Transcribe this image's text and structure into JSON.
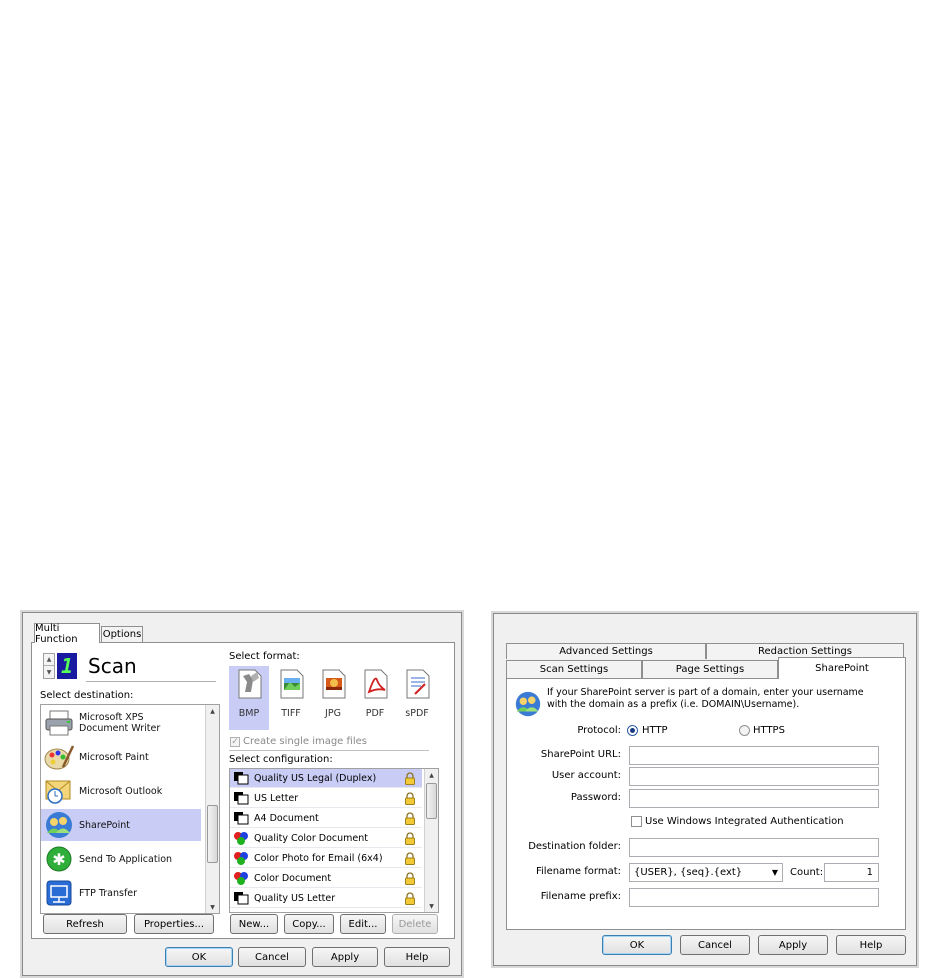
{
  "left_dialog": {
    "tabs": [
      "Multi Function",
      "Options"
    ],
    "function_title": "Scan",
    "function_number": "1",
    "select_destination_label": "Select destination:",
    "destinations": [
      {
        "label": "Microsoft XPS Document Writer",
        "icon": "printer-icon"
      },
      {
        "label": "Microsoft Paint",
        "icon": "paint-palette-icon"
      },
      {
        "label": "Microsoft Outlook",
        "icon": "outlook-icon"
      },
      {
        "label": "SharePoint",
        "icon": "sharepoint-icon",
        "selected": true
      },
      {
        "label": "Send To Application",
        "icon": "send-to-app-icon"
      },
      {
        "label": "FTP Transfer",
        "icon": "ftp-icon"
      }
    ],
    "select_format_label": "Select format:",
    "formats": [
      {
        "label": "BMP",
        "icon": "bmp-icon",
        "selected": true
      },
      {
        "label": "TIFF",
        "icon": "tiff-icon"
      },
      {
        "label": "JPG",
        "icon": "jpg-icon"
      },
      {
        "label": "PDF",
        "icon": "pdf-icon"
      },
      {
        "label": "sPDF",
        "icon": "spdf-icon"
      }
    ],
    "create_single_image_label": "Create single image files",
    "select_configuration_label": "Select configuration:",
    "configurations": [
      {
        "label": "Quality US Legal (Duplex)",
        "icon": "bw-doc-icon",
        "selected": true
      },
      {
        "label": "US Letter",
        "icon": "bw-doc-icon"
      },
      {
        "label": "A4 Document",
        "icon": "bw-doc-icon"
      },
      {
        "label": "Quality Color Document",
        "icon": "color-doc-icon"
      },
      {
        "label": "Color Photo for Email (6x4)",
        "icon": "color-doc-icon"
      },
      {
        "label": "Color Document",
        "icon": "color-doc-icon"
      },
      {
        "label": "Quality US Letter",
        "icon": "bw-doc-icon"
      }
    ],
    "buttons": {
      "refresh": "Refresh",
      "properties": "Properties...",
      "new": "New...",
      "copy": "Copy...",
      "edit": "Edit...",
      "delete": "Delete",
      "ok": "OK",
      "cancel": "Cancel",
      "apply": "Apply",
      "help": "Help"
    }
  },
  "right_dialog": {
    "tabs_row1": [
      "Advanced Settings",
      "Redaction Settings"
    ],
    "tabs_row2": [
      "Scan Settings",
      "Page Settings",
      "SharePoint"
    ],
    "info_text_line1": "If your SharePoint server is part of a domain, enter your username",
    "info_text_line2": "with the domain as a prefix (i.e. DOMAIN\\Username).",
    "protocol_label": "Protocol:",
    "protocol_http": "HTTP",
    "protocol_https": "HTTPS",
    "protocol_selected": "HTTP",
    "sharepoint_url_label": "SharePoint URL:",
    "user_account_label": "User account:",
    "password_label": "Password:",
    "use_windows_auth_label": "Use Windows Integrated Authentication",
    "destination_folder_label": "Destination folder:",
    "filename_format_label": "Filename format:",
    "filename_format_value": "{USER}, {seq}.{ext}",
    "count_label": "Count:",
    "count_value": "1",
    "filename_prefix_label": "Filename prefix:",
    "buttons": {
      "ok": "OK",
      "cancel": "Cancel",
      "apply": "Apply",
      "help": "Help"
    }
  }
}
